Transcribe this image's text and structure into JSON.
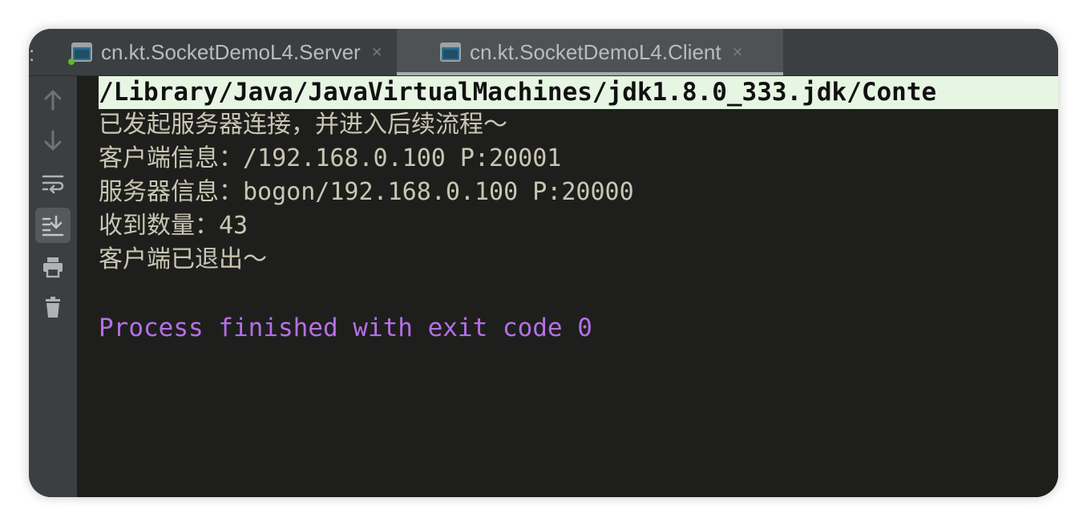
{
  "tabs": {
    "prefix": ":",
    "items": [
      {
        "label": "cn.kt.SocketDemoL4.Server",
        "close": "×"
      },
      {
        "label": "cn.kt.SocketDemoL4.Client",
        "close": "×"
      }
    ]
  },
  "sidebar": {
    "tools": [
      "up-arrow-icon",
      "down-arrow-icon",
      "soft-wrap-icon",
      "scroll-to-end-icon",
      "print-icon",
      "trash-icon"
    ]
  },
  "console": {
    "command": "/Library/Java/JavaVirtualMachines/jdk1.8.0_333.jdk/Conte",
    "lines": [
      "已发起服务器连接，并进入后续流程～",
      "客户端信息：/192.168.0.100 P:20001",
      "服务器信息：bogon/192.168.0.100 P:20000",
      "收到数量：43",
      "客户端已退出～"
    ],
    "exit_message": "Process finished with exit code 0"
  },
  "colors": {
    "console_bg": "#1e1f1c",
    "command_bg": "#e6f6e3",
    "text": "#c9c6b4",
    "exit_text": "#b56fe6",
    "run_indicator": "#5fb832"
  }
}
